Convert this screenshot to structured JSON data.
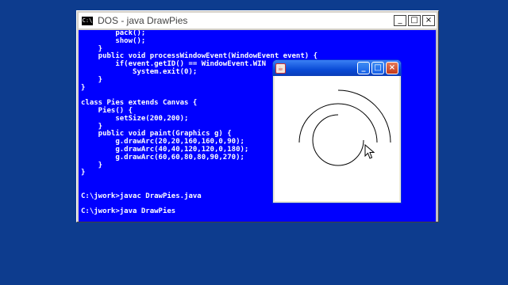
{
  "dos_window": {
    "title": "DOS - java DrawPies",
    "sys_icon": "C:\\",
    "buttons": {
      "minimize": "_",
      "maximize": "□",
      "close": "×"
    },
    "console_lines": [
      "        pack();",
      "        show();",
      "    }",
      "    public void processWindowEvent(WindowEvent event) {",
      "        if(event.getID() == WindowEvent.WIN",
      "            System.exit(0);",
      "    }",
      "}",
      "",
      "class Pies extends Canvas {",
      "    Pies() {",
      "        setSize(200,200);",
      "    }",
      "    public void paint(Graphics g) {",
      "        g.drawArc(20,20,160,160,0,90);",
      "        g.drawArc(40,40,120,120,0,180);",
      "        g.drawArc(60,60,80,80,90,270);",
      "    }",
      "}",
      "",
      "",
      "C:\\jwork>javac DrawPies.java",
      "",
      "C:\\jwork>java DrawPies"
    ]
  },
  "java_window": {
    "icon": "☕",
    "buttons": {
      "minimize": "_",
      "maximize": "□",
      "close": "×"
    }
  },
  "colors": {
    "desktop": "#0d3c8e",
    "console_bg": "#0000ff",
    "console_text": "#ffffff"
  }
}
